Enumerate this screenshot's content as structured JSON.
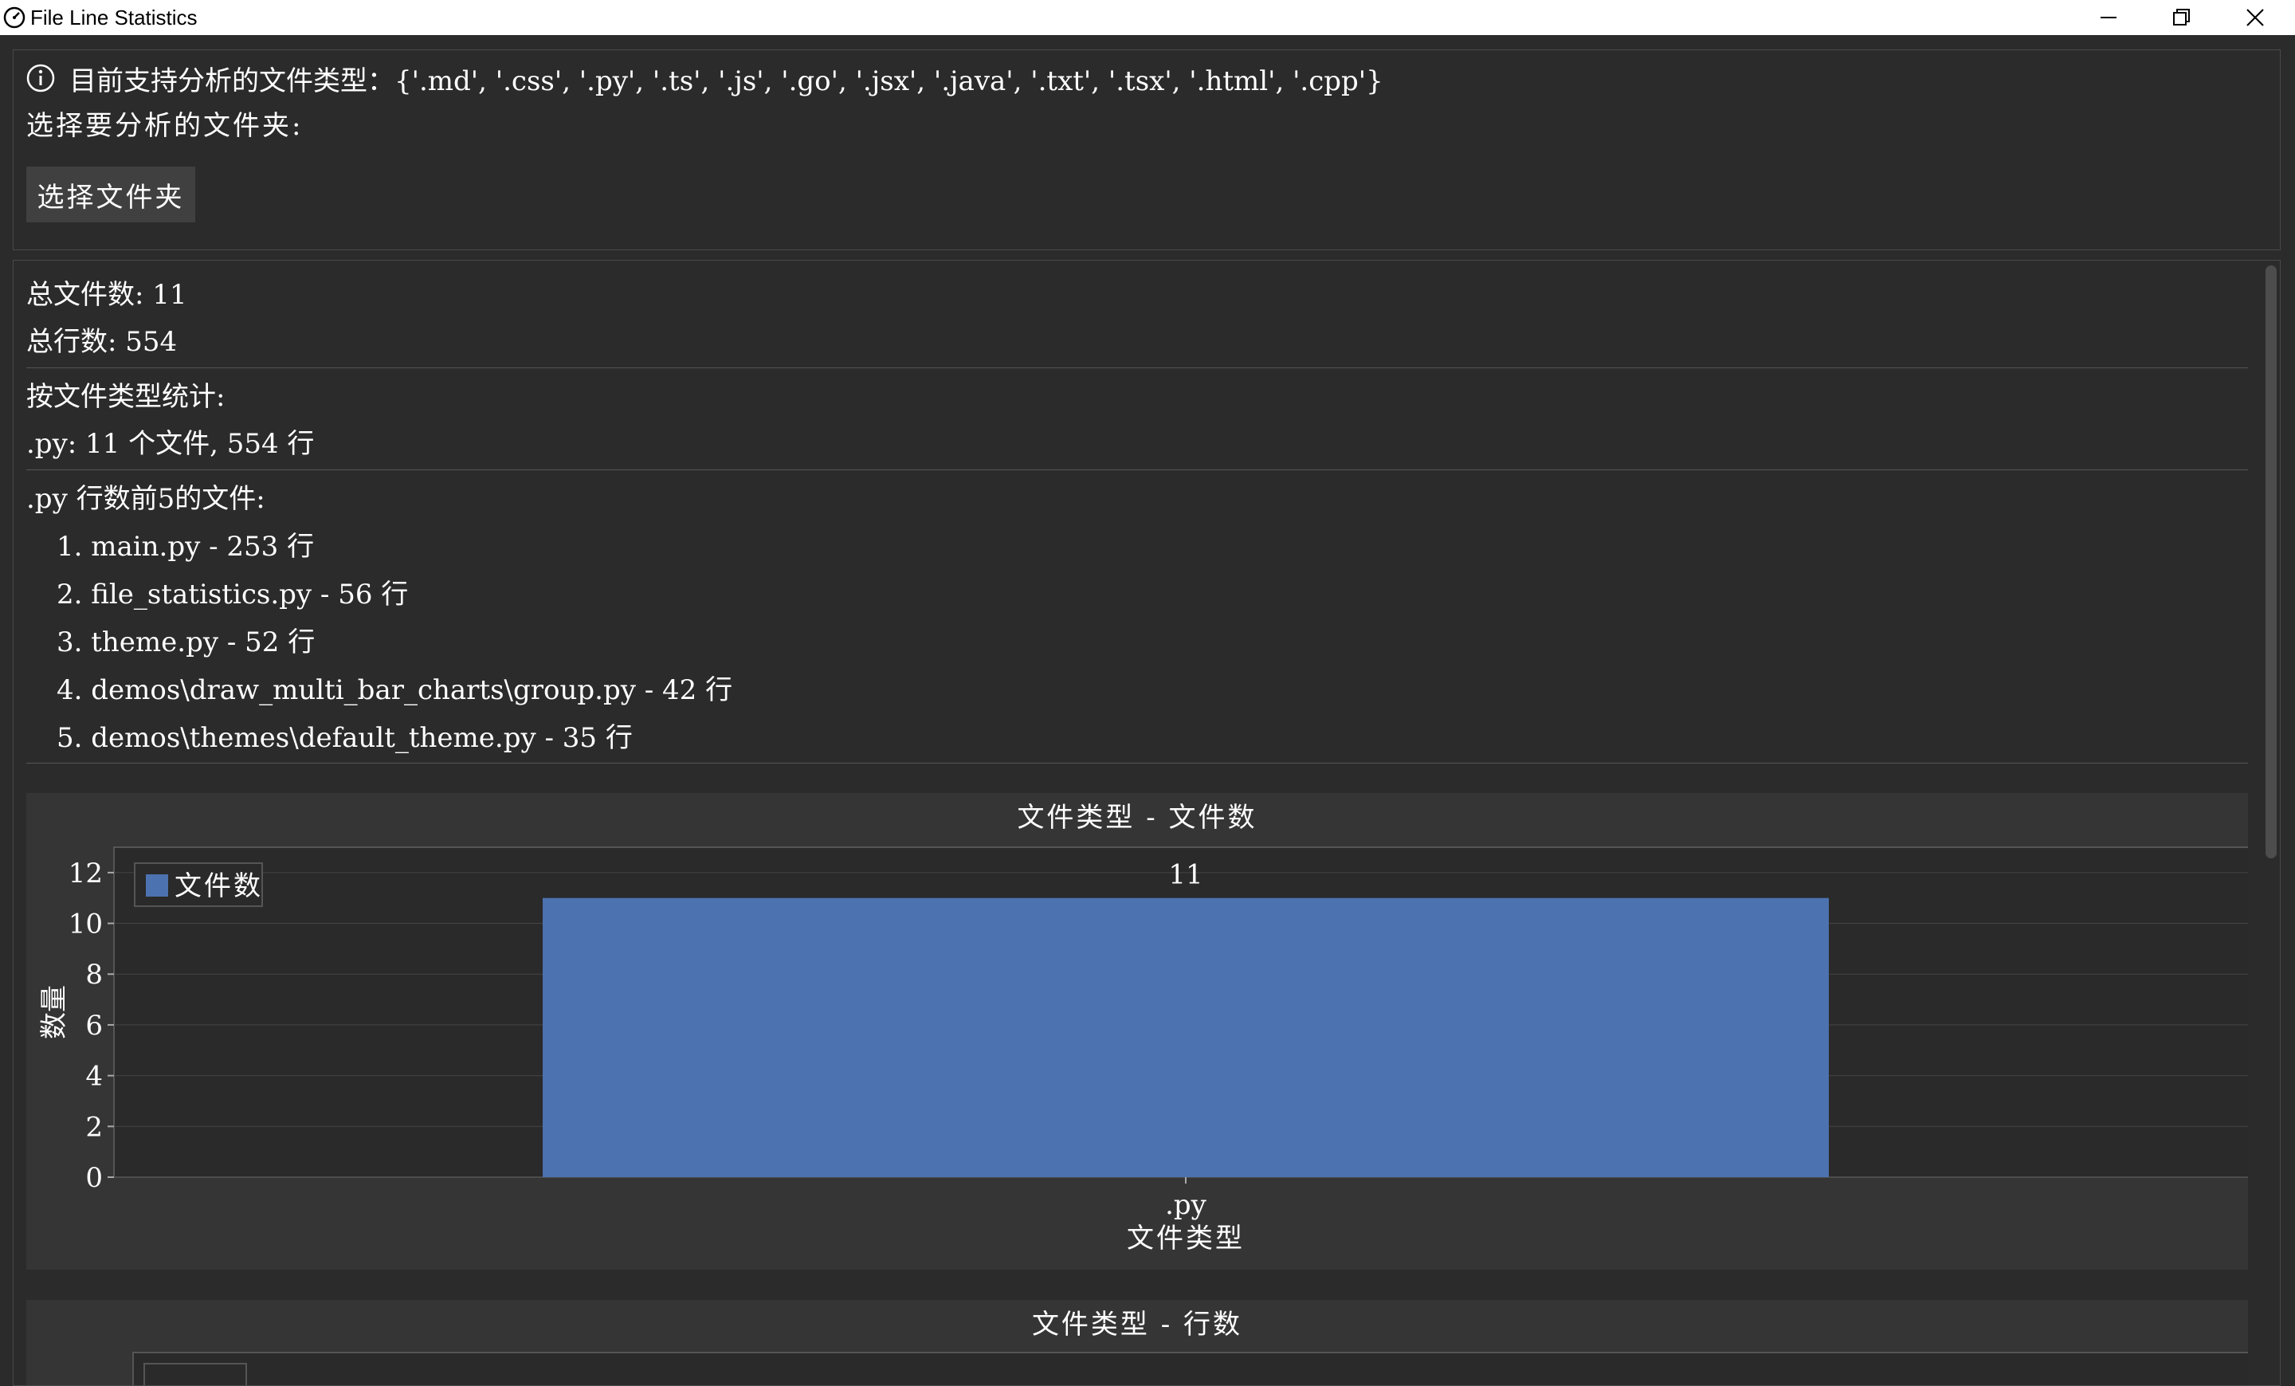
{
  "window": {
    "title": "File Line Statistics",
    "minimize_icon": "minimize-icon",
    "maximize_icon": "restore-icon",
    "close_icon": "close-icon"
  },
  "top_panel": {
    "info_text": "目前支持分析的文件类型：{'.md', '.css', '.py', '.ts', '.js', '.go', '.jsx', '.java', '.txt', '.tsx', '.html', '.cpp'}",
    "choose_label": "选择要分析的文件夹:",
    "choose_button": "选择文件夹"
  },
  "summary": {
    "total_files": "总文件数: 11",
    "total_lines": "总行数: 554"
  },
  "by_type": {
    "heading": "按文件类型统计:",
    "rows": [
      ".py: 11 个文件, 554 行"
    ]
  },
  "top_files": {
    "heading": ".py 行数前5的文件:",
    "items": [
      "1. main.py - 253 行",
      "2. file_statistics.py - 56 行",
      "3. theme.py - 52 行",
      "4. demos\\draw_multi_bar_charts\\group.py - 42 行",
      "5. demos\\themes\\default_theme.py - 35 行"
    ]
  },
  "colors": {
    "background": "#2b2b2b",
    "chart_background": "#353535",
    "plot_background": "#2a2a2a",
    "bar": "#4c72b0",
    "grid": "#444444"
  },
  "chart_data": [
    {
      "type": "bar",
      "title": "文件类型 - 文件数",
      "categories": [
        ".py"
      ],
      "series": [
        {
          "name": "文件数",
          "values": [
            11
          ]
        }
      ],
      "data_labels": [
        "11"
      ],
      "xlabel": "文件类型",
      "ylabel": "数量",
      "ylim": [
        0,
        13
      ],
      "yticks": [
        0,
        2,
        4,
        6,
        8,
        10,
        12
      ],
      "grid": true,
      "legend": "top-left"
    },
    {
      "type": "bar",
      "title": "文件类型 - 行数"
    }
  ]
}
